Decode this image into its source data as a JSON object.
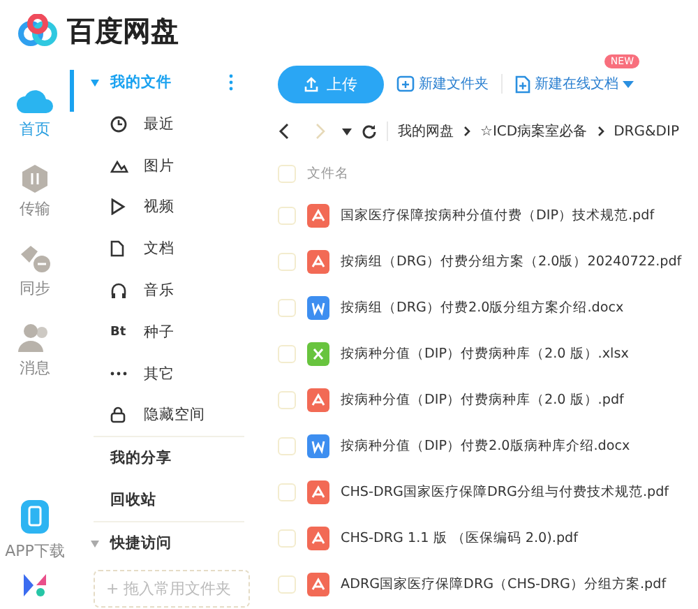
{
  "app": {
    "name": "百度网盘"
  },
  "rail": [
    {
      "label": "首页",
      "kind": "home",
      "selected": true
    },
    {
      "label": "传输",
      "kind": "transfer",
      "selected": false
    },
    {
      "label": "同步",
      "kind": "sync",
      "selected": false
    },
    {
      "label": "消息",
      "kind": "message",
      "selected": false
    }
  ],
  "rail_bottom": [
    {
      "label": "APP下载",
      "kind": "phone"
    },
    {
      "kind": "app"
    }
  ],
  "nav": {
    "my_files": {
      "label": "我的文件",
      "expanded": true,
      "selected": true,
      "children": [
        {
          "label": "最近",
          "kind": "clock"
        },
        {
          "label": "图片",
          "kind": "image"
        },
        {
          "label": "视频",
          "kind": "video"
        },
        {
          "label": "文档",
          "kind": "doc"
        },
        {
          "label": "音乐",
          "kind": "music"
        },
        {
          "label": "种子",
          "kind": "torrent",
          "glyph": "Bt"
        },
        {
          "label": "其它",
          "kind": "more"
        },
        {
          "label": "隐藏空间",
          "kind": "lock"
        }
      ]
    },
    "links": [
      "我的分享",
      "回收站"
    ],
    "quick_access": {
      "label": "快捷访问",
      "expanded": true,
      "drop_hint": "+ 拖入常用文件夹"
    }
  },
  "toolbar": {
    "upload": "上传",
    "new_folder": "新建文件夹",
    "new_doc": "新建在线文档",
    "new_badge": "NEW"
  },
  "breadcrumb": [
    "我的网盘",
    "☆ICD病案室必备",
    "DRG&DIP"
  ],
  "table": {
    "column": "文件名",
    "select_all": {
      "checked": false
    },
    "rows": [
      {
        "name": "国家医疗保障按病种分值付费（DIP）技术规范.pdf",
        "kind": "pdf",
        "checked": false
      },
      {
        "name": "按病组（DRG）付费分组方案（2.0版）20240722.pdf",
        "kind": "pdf",
        "checked": false
      },
      {
        "name": "按病组（DRG）付费2.0版分组方案介绍.docx",
        "kind": "docx",
        "checked": false
      },
      {
        "name": "按病种分值（DIP）付费病种库（2.0 版）.xlsx",
        "kind": "xlsx",
        "checked": false
      },
      {
        "name": "按病种分值（DIP）付费病种库（2.0 版）.pdf",
        "kind": "pdf",
        "checked": false
      },
      {
        "name": "按病种分值（DIP）付费2.0版病种库介绍.docx",
        "kind": "docx",
        "checked": false
      },
      {
        "name": "CHS-DRG国家医疗保障DRG分组与付费技术规范.pdf",
        "kind": "pdf",
        "checked": false
      },
      {
        "name": "CHS-DRG 1.1 版 （医保编码 2.0).pdf",
        "kind": "pdf",
        "checked": false
      },
      {
        "name": "ADRG国家医疗保障DRG（CHS-DRG）分组方案.pdf",
        "kind": "pdf",
        "checked": false
      }
    ]
  }
}
